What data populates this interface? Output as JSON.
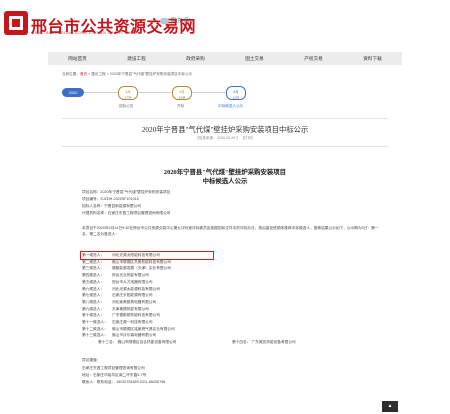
{
  "header": {
    "site_name": "邢台市公共资源交易网",
    "site_pinyin": "XING TAI SHI GONG GONG ZI YUAN JIAO YI WANG",
    "weather": "阴(东 风)"
  },
  "nav": {
    "items": [
      "网站首页",
      "建设工程",
      "政府采购",
      "国土交易",
      "产权交易",
      "资料下载"
    ]
  },
  "breadcrumb": {
    "prefix": "当前位置：",
    "home": "首页",
    "path": " > 建设工程 > 2020年宁晋县\"气代煤\"壁挂炉采购安装项目中标公示"
  },
  "steps": {
    "start": "2020",
    "nodes": [
      {
        "date": "4月",
        "sub": "17号",
        "label": "招标公告"
      },
      {
        "date": "4月",
        "sub": "24号",
        "label": "开标"
      },
      {
        "date": "5月",
        "sub": "19号",
        "label": "中标候选人公示"
      }
    ]
  },
  "article": {
    "title": "2020年宁晋县\"气代煤\"壁挂炉采购安装项目中标公示",
    "meta": "【信息来源：   2020-05-19 】  【打印】",
    "doc_title": "2020年宁晋县\"气代煤\"壁挂炉采购安装项目",
    "doc_subtitle": "中标候选人公示",
    "lines": [
      "项目名称：2020年宁晋县\"气代煤\"壁挂炉采购安装项目",
      "项目编号：SJZDH-2020SF101015",
      "招标人名称：宁晋县新能源有限公司",
      "代理机构名称：石家庄东昌工程项目管理咨询有限公司"
    ],
    "paragraph": "    本项目于2020年4月24日9:30在邢台市公共资源交易中心第九评标室评标委员会依据招标文件中的评标办法，按由高至低顺序推荐中标候选人，推荐结果公示如下，公示期为3日：第一名、第二名为备选人：",
    "candidates": [
      {
        "rank": "第一候选人：",
        "name": "河北光源太阳能科技有限公司"
      },
      {
        "rank": "第二候选人：",
        "name": "佛山市顺德区杰美热能科技有限公司"
      },
      {
        "rank": "第三候选人：",
        "name": "德都能源发展（天津）实业有限公司"
      },
      {
        "rank": "第四候选人：",
        "name": "邢台天业热能有限公司"
      },
      {
        "rank": "第五候选人：",
        "name": "邢台市大力电器有限公司"
      },
      {
        "rank": "第六候选人：",
        "name": "河北光源太能源科技有限公司"
      },
      {
        "rank": "第七候选人：",
        "name": "石家庄长阳能源有限公司"
      },
      {
        "rank": "第八候选人：",
        "name": "河北家美厨具电器有限公司"
      },
      {
        "rank": "第九候选人：",
        "name": "天津奥德热能有限公司"
      },
      {
        "rank": "第十候选人：",
        "name": "广东德斯顿热能科技有限公司"
      },
      {
        "rank": "第十一候选人：",
        "name": "石家庄源一科技有限公司"
      },
      {
        "rank": "第十二候选人：",
        "name": "佛山市顺德区铭家燃气具实业有限公司"
      },
      {
        "rank": "第十三候选人：",
        "name": "佛山市沃尔森电器有限公司"
      }
    ],
    "row_extra": {
      "a": "第十三名：  佛山市顺德区百合热能设备有限公司",
      "b": "第十四名：  广东美凯热能设备有限公司"
    },
    "contact_lines": [
      "异议渠道：",
      "石家庄东昌工程项目管理咨询有限公司",
      "地址：石家庄市裕华区南二环东路3-7号",
      "联系人：联系电话：          15032781659          0311-86255796"
    ]
  },
  "scroll_top": "▲"
}
